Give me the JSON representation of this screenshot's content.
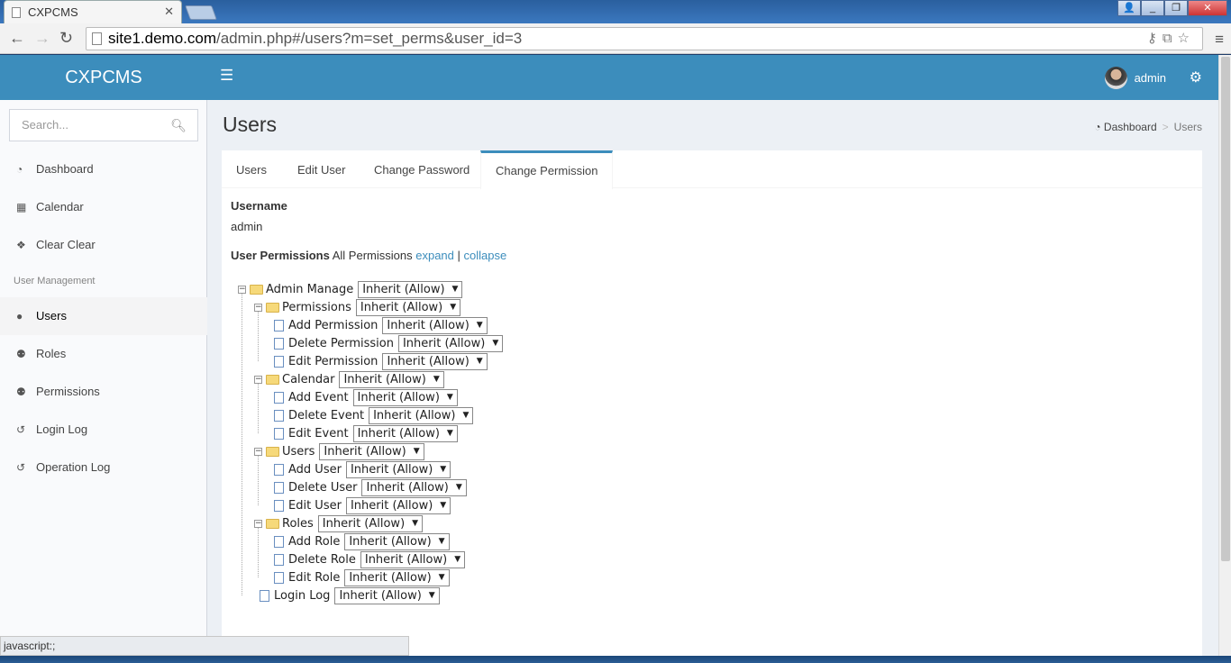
{
  "browser": {
    "tab_title": "CXPCMS",
    "url_host": "site1.demo.com",
    "url_path": "/admin.php#/users?m=set_perms&user_id=3",
    "status_text": "javascript:;"
  },
  "header": {
    "logo": "CXPCMS",
    "username": "admin"
  },
  "sidebar": {
    "search_placeholder": "Search...",
    "items_top": [
      {
        "label": "Dashboard",
        "icon": "dashboard-icon"
      },
      {
        "label": "Calendar",
        "icon": "calendar-icon"
      },
      {
        "label": "Clear Clear",
        "icon": "cubes-icon"
      }
    ],
    "section_header": "User Management",
    "items_um": [
      {
        "label": "Users",
        "icon": "user-icon"
      },
      {
        "label": "Roles",
        "icon": "users-icon"
      },
      {
        "label": "Permissions",
        "icon": "users-icon"
      },
      {
        "label": "Login Log",
        "icon": "history-icon"
      },
      {
        "label": "Operation Log",
        "icon": "history-icon"
      }
    ]
  },
  "page": {
    "title": "Users",
    "breadcrumb": [
      "Dashboard",
      "Users"
    ],
    "tabs": [
      "Users",
      "Edit User",
      "Change Password",
      "Change Permission"
    ],
    "username_label": "Username",
    "username_value": "admin",
    "perm_label": "User Permissions",
    "perm_all": "All Permissions",
    "expand": "expand",
    "divider": "|",
    "collapse": "collapse"
  },
  "tree": [
    {
      "label": "Admin Manage",
      "value": "Inherit (Allow)"
    },
    {
      "label": "Permissions",
      "value": "Inherit (Allow)"
    },
    {
      "label": "Add Permission",
      "value": "Inherit (Allow)"
    },
    {
      "label": "Delete Permission",
      "value": "Inherit (Allow)"
    },
    {
      "label": "Edit Permission",
      "value": "Inherit (Allow)"
    },
    {
      "label": "Calendar",
      "value": "Inherit (Allow)"
    },
    {
      "label": "Add Event",
      "value": "Inherit (Allow)"
    },
    {
      "label": "Delete Event",
      "value": "Inherit (Allow)"
    },
    {
      "label": "Edit Event",
      "value": "Inherit (Allow)"
    },
    {
      "label": "Users",
      "value": "Inherit (Allow)"
    },
    {
      "label": "Add User",
      "value": "Inherit (Allow)"
    },
    {
      "label": "Delete User",
      "value": "Inherit (Allow)"
    },
    {
      "label": "Edit User",
      "value": "Inherit (Allow)"
    },
    {
      "label": "Roles",
      "value": "Inherit (Allow)"
    },
    {
      "label": "Add Role",
      "value": "Inherit (Allow)"
    },
    {
      "label": "Delete Role",
      "value": "Inherit (Allow)"
    },
    {
      "label": "Edit Role",
      "value": "Inherit (Allow)"
    },
    {
      "label": "Login Log",
      "value": "Inherit (Allow)"
    }
  ]
}
